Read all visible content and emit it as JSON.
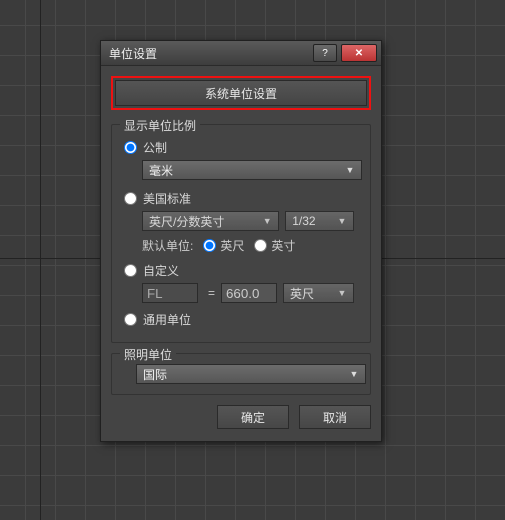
{
  "window": {
    "title": "单位设置",
    "help_glyph": "?",
    "close_glyph": "✕"
  },
  "system_unit_button": "系统单位设置",
  "display_group": {
    "legend": "显示单位比例",
    "metric_label": "公制",
    "metric_value": "毫米",
    "us_label": "美国标准",
    "us_format": "英尺/分数英寸",
    "us_fraction": "1/32",
    "default_unit_label": "默认单位:",
    "feet_label": "英尺",
    "inch_label": "英寸",
    "custom_label": "自定义",
    "custom_prefix": "FL",
    "custom_value": "660.0",
    "custom_unit": "英尺",
    "generic_label": "通用单位"
  },
  "lighting_group": {
    "legend": "照明单位",
    "value": "国际"
  },
  "buttons": {
    "ok": "确定",
    "cancel": "取消"
  }
}
